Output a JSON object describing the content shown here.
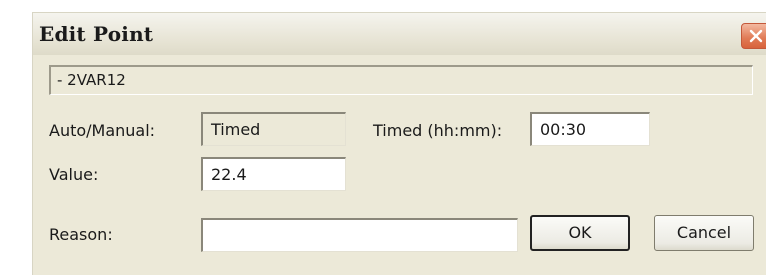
{
  "dialog": {
    "title": "Edit Point",
    "close_icon": "close-icon",
    "point_name": "- 2VAR12",
    "auto_manual_label": "Auto/Manual:",
    "auto_manual_value": "Timed",
    "timed_label": "Timed (hh:mm):",
    "timed_value": "00:30",
    "value_label": "Value:",
    "value_value": "22.4",
    "reason_label": "Reason:",
    "reason_value": "",
    "ok_label": "OK",
    "cancel_label": "Cancel"
  },
  "colors": {
    "dialog_bg": "#ece9d8",
    "close_button": "#e07a55"
  }
}
